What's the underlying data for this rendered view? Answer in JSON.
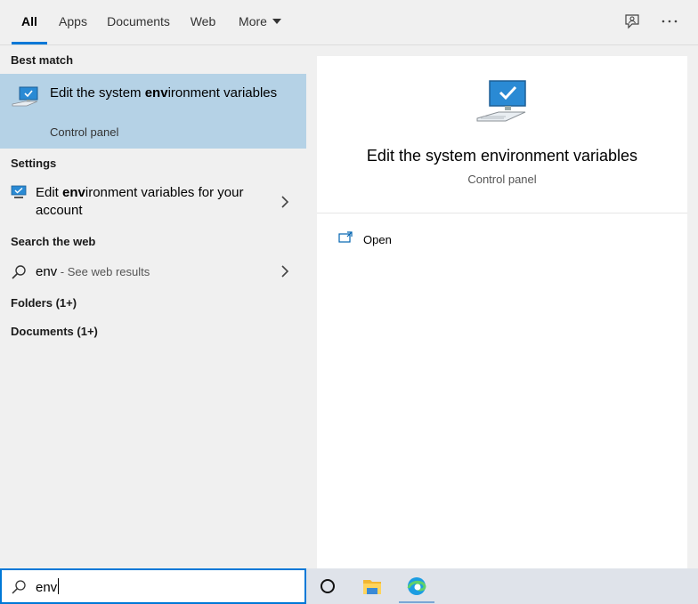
{
  "tabs": [
    "All",
    "Apps",
    "Documents",
    "Web",
    "More"
  ],
  "sections": {
    "best_match": "Best match",
    "settings": "Settings",
    "search_web": "Search the web",
    "folders": "Folders (1+)",
    "documents": "Documents (1+)"
  },
  "best_match_item": {
    "title_pre": "Edit the system ",
    "title_bold": "env",
    "title_post": "ironment variables",
    "subtitle": "Control panel"
  },
  "settings_item": {
    "pre": "Edit ",
    "bold": "env",
    "post": "ironment variables for your account"
  },
  "web_item": {
    "query": "env",
    "suffix": " - See web results"
  },
  "preview": {
    "title": "Edit the system environment variables",
    "subtitle": "Control panel",
    "action_open": "Open"
  },
  "search": {
    "value": "env"
  },
  "colors": {
    "accent": "#0078d7",
    "selected_bg": "#b5d2e6"
  }
}
